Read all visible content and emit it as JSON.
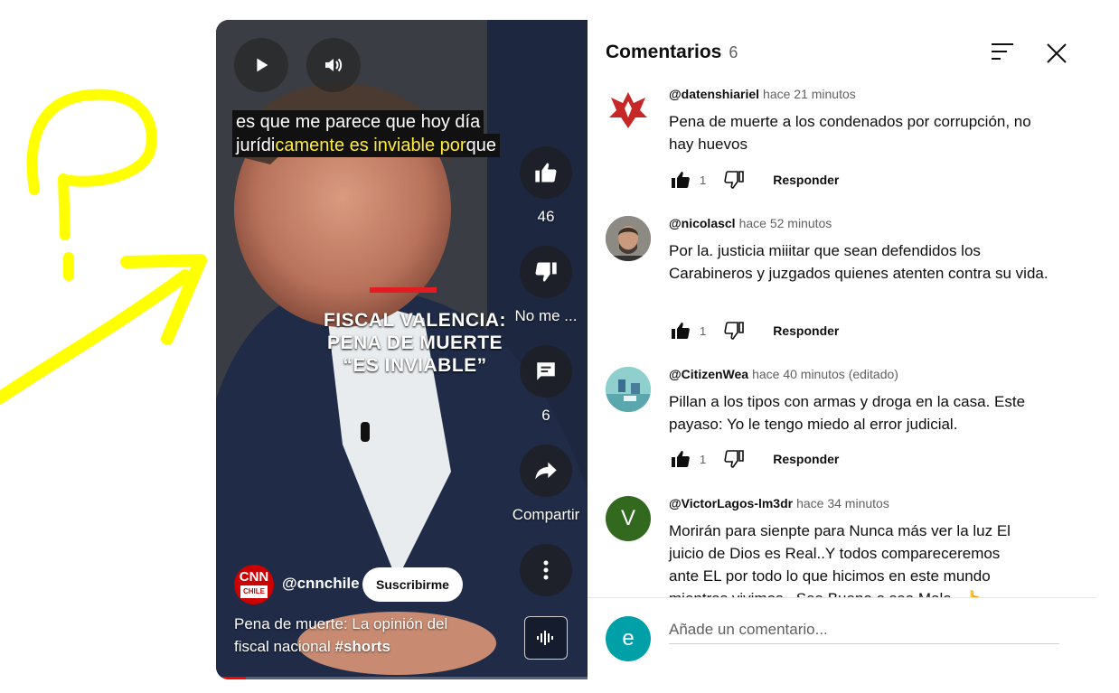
{
  "video": {
    "caption_line1": "es que me parece que hoy día",
    "caption_line2_white": "jurídi",
    "caption_line2_yellow": "camente es inviable por",
    "caption_line2_end": "que",
    "headline_line1": "FISCAL VALENCIA:",
    "headline_line2": "PENA DE MUERTE",
    "headline_line3": "“ES INVIABLE”",
    "like_count": "46",
    "dislike_label": "No me ...",
    "comment_count": "6",
    "share_label": "Compartir",
    "channel_logo_text": "CNN",
    "channel_logo_sub": "CHILE",
    "channel_handle": "@cnnchile",
    "subscribe_label": "Suscribirme",
    "title_text": "Pena de muerte: La opinión del fiscal nacional ",
    "title_hashtag": "#shorts",
    "progress_fraction": 0.08
  },
  "comments": {
    "title": "Comentarios",
    "count": "6",
    "input_placeholder": "Añade un comentario...",
    "user_initial": "e",
    "items": [
      {
        "author": "@datenshiariel",
        "time": "hace 21 minutos",
        "text": "Pena de muerte a los condenados por corrupción, no hay huevos",
        "likes": "1",
        "reply_label": "Responder"
      },
      {
        "author": "@nicolascl",
        "time": "hace 52 minutos",
        "text": "Por la. justicia miiitar que sean defendidos los Carabineros y juzgados quienes atenten contra su vida.",
        "likes": "1",
        "reply_label": "Responder"
      },
      {
        "author": "@CitizenWea",
        "time": "hace 40 minutos (editado)",
        "text": "Pillan a los tipos con armas y droga en la casa. Este payaso: Yo le tengo miedo al error judicial.",
        "likes": "1",
        "reply_label": "Responder"
      },
      {
        "author": "@VictorLagos-lm3dr",
        "time": "hace 34 minutos",
        "avatar_initial": "V",
        "text": "Morirán para sienpte para Nunca más ver la luz El juicio de Dios es Real..Y todos compareceremos ante EL  por todo lo que hicimos en este mundo mientras vivimos...Sea Bueno o sea Malo...👆"
      }
    ]
  },
  "colors": {
    "scribble": "#ffff00",
    "accent_red": "#ff0000",
    "caption_highlight": "#ffeb3b",
    "user_avatar": "#00a0a8",
    "victor_avatar": "#33691e"
  }
}
